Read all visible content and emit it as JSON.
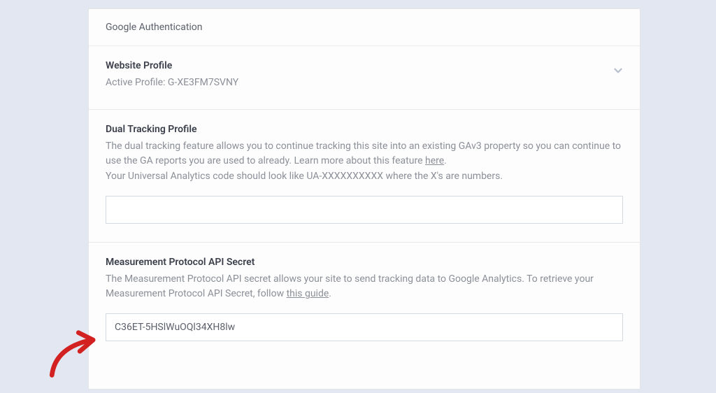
{
  "header": {
    "title": "Google Authentication"
  },
  "websiteProfile": {
    "title": "Website Profile",
    "subtext": "Active Profile: G-XE3FM7SVNY"
  },
  "dualTracking": {
    "title": "Dual Tracking Profile",
    "line1_part1": "The dual tracking feature allows you to continue tracking this site into an existing GAv3 property so you can continue to use the GA reports you are used to already. Learn more about this feature ",
    "line1_link": "here",
    "line1_part2": ".",
    "line2": "Your Universal Analytics code should look like UA-XXXXXXXXXX where the X's are numbers.",
    "inputValue": ""
  },
  "measurementProtocol": {
    "title": "Measurement Protocol API Secret",
    "desc_part1": "The Measurement Protocol API secret allows your site to send tracking data to Google Analytics. To retrieve your Measurement Protocol API Secret, follow ",
    "desc_link": "this guide",
    "desc_part2": ".",
    "inputValue": "C36ET-5HSlWuOQl34XH8lw"
  }
}
